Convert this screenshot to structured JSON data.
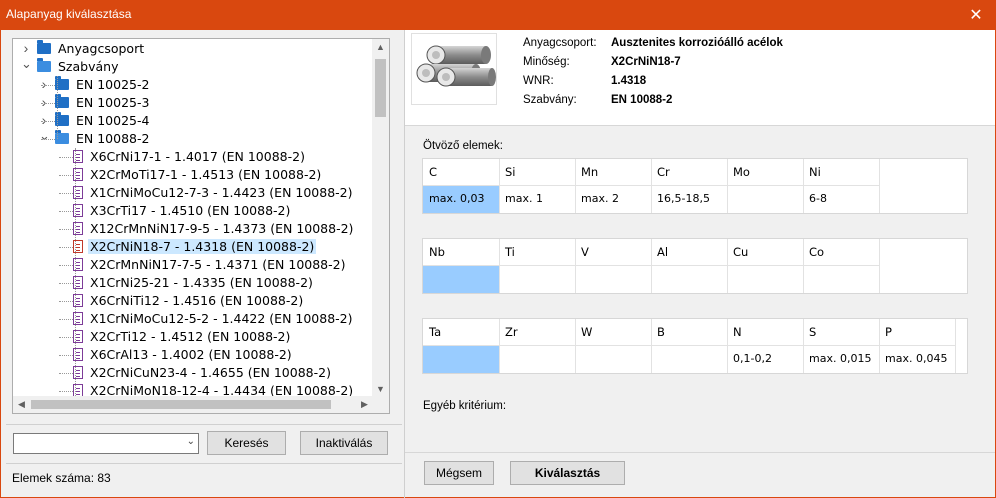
{
  "window": {
    "title": "Alapanyag kiválasztása",
    "close": "✕"
  },
  "tree": {
    "root_items": [
      {
        "label": "Anyagcsoport",
        "expanded": false
      },
      {
        "label": "Szabvány",
        "expanded": true
      }
    ],
    "standards": [
      {
        "label": "EN 10025-2",
        "expanded": false
      },
      {
        "label": "EN 10025-3",
        "expanded": false
      },
      {
        "label": "EN 10025-4",
        "expanded": false
      },
      {
        "label": "EN 10088-2",
        "expanded": true
      }
    ],
    "materials": [
      "X6CrNi17-1 - 1.4017 (EN 10088-2)",
      "X2CrMoTi17-1 - 1.4513 (EN 10088-2)",
      "X1CrNiMoCu12-7-3 - 1.4423 (EN 10088-2)",
      "X3CrTi17 - 1.4510 (EN 10088-2)",
      "X12CrMnNiN17-9-5 - 1.4373 (EN 10088-2)",
      "X2CrNiN18-7 - 1.4318 (EN 10088-2)",
      "X2CrMnNiN17-7-5 - 1.4371 (EN 10088-2)",
      "X1CrNi25-21 - 1.4335 (EN 10088-2)",
      "X6CrNiTi12 - 1.4516 (EN 10088-2)",
      "X1CrNiMoCu12-5-2 - 1.4422 (EN 10088-2)",
      "X2CrTi12 - 1.4512 (EN 10088-2)",
      "X6CrAl13 - 1.4002 (EN 10088-2)",
      "X2CrNiCuN23-4 - 1.4655 (EN 10088-2)",
      "X2CrNiMoN18-12-4 - 1.4434 (EN 10088-2)"
    ],
    "selected": "X2CrNiN18-7 - 1.4318 (EN 10088-2)"
  },
  "search": {
    "value": "",
    "search_label": "Keresés",
    "deactivate_label": "Inaktiválás"
  },
  "status": {
    "count_text": "Elemek száma: 83"
  },
  "info": {
    "group_label": "Anyagcsoport:",
    "group_value": "Ausztenites korrozióálló acélok",
    "grade_label": "Minőség:",
    "grade_value": "X2CrNiN18-7",
    "wnr_label": "WNR:",
    "wnr_value": "1.4318",
    "std_label": "Szabvány:",
    "std_value": "EN 10088-2"
  },
  "elements_label": "Ötvöző elemek:",
  "element_tables": [
    {
      "headers": [
        "C",
        "Si",
        "Mn",
        "Cr",
        "Mo",
        "Ni",
        ""
      ],
      "values": [
        "max. 0,03",
        "max. 1",
        "max. 2",
        "16,5-18,5",
        "",
        "6-8",
        ""
      ]
    },
    {
      "headers": [
        "Nb",
        "Ti",
        "V",
        "Al",
        "Cu",
        "Co",
        ""
      ],
      "values": [
        "",
        "",
        "",
        "",
        "",
        "",
        ""
      ]
    },
    {
      "headers": [
        "Ta",
        "Zr",
        "W",
        "B",
        "N",
        "S",
        "P"
      ],
      "values": [
        "",
        "",
        "",
        "",
        "0,1-0,2",
        "max. 0,015",
        "max. 0,045"
      ]
    }
  ],
  "criteria_label": "Egyéb kritérium:",
  "buttons": {
    "cancel": "Mégsem",
    "select": "Kiválasztás"
  }
}
